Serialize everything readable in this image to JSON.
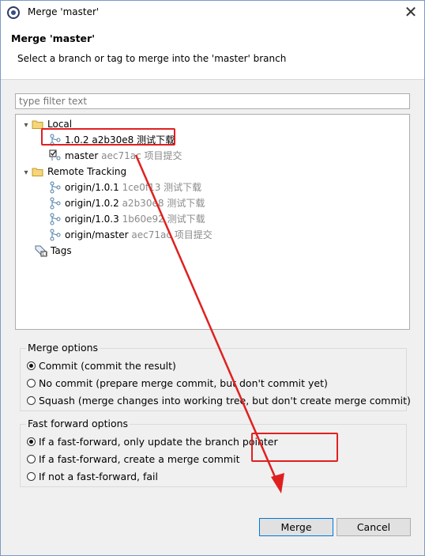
{
  "window": {
    "title": "Merge 'master'",
    "close_glyph": "✕"
  },
  "banner": {
    "heading": "Merge 'master'",
    "description": "Select a branch or tag to merge into the 'master' branch"
  },
  "filter": {
    "placeholder": "type filter text"
  },
  "tree": {
    "local_label": "Local",
    "local_items": [
      {
        "name": "1.0.2",
        "hash": "a2b30e8",
        "message": "测试下载",
        "selected": true
      },
      {
        "name": "master",
        "hash": "aec71ac",
        "message": "项目提交",
        "checked_out": true
      }
    ],
    "remote_label": "Remote Tracking",
    "remote_items": [
      {
        "name": "origin/1.0.1",
        "hash": "1ce0f13",
        "message": "测试下载"
      },
      {
        "name": "origin/1.0.2",
        "hash": "a2b30e8",
        "message": "测试下载"
      },
      {
        "name": "origin/1.0.3",
        "hash": "1b60e92",
        "message": "测试下载"
      },
      {
        "name": "origin/master",
        "hash": "aec71ac",
        "message": "项目提交"
      }
    ],
    "tags_label": "Tags"
  },
  "merge_options": {
    "legend": "Merge options",
    "options": [
      {
        "label": "Commit (commit the result)",
        "selected": true
      },
      {
        "label": "No commit (prepare merge commit, but don't commit yet)",
        "selected": false
      },
      {
        "label": "Squash (merge changes into working tree, but don't create merge commit)",
        "selected": false
      }
    ]
  },
  "ff_options": {
    "legend": "Fast forward options",
    "options": [
      {
        "label": "If a fast-forward, only update the branch pointer",
        "selected": true
      },
      {
        "label": "If a fast-forward, create a merge commit",
        "selected": false
      },
      {
        "label": "If not a fast-forward, fail",
        "selected": false
      }
    ]
  },
  "buttons": {
    "merge_label": "Merge",
    "cancel_label": "Cancel"
  },
  "annotation_color": "#e02020",
  "icons": {
    "app": "eclipse-icon",
    "folder": "folder-icon",
    "branch": "branch-icon",
    "tags": "tags-icon",
    "close": "close-icon"
  }
}
